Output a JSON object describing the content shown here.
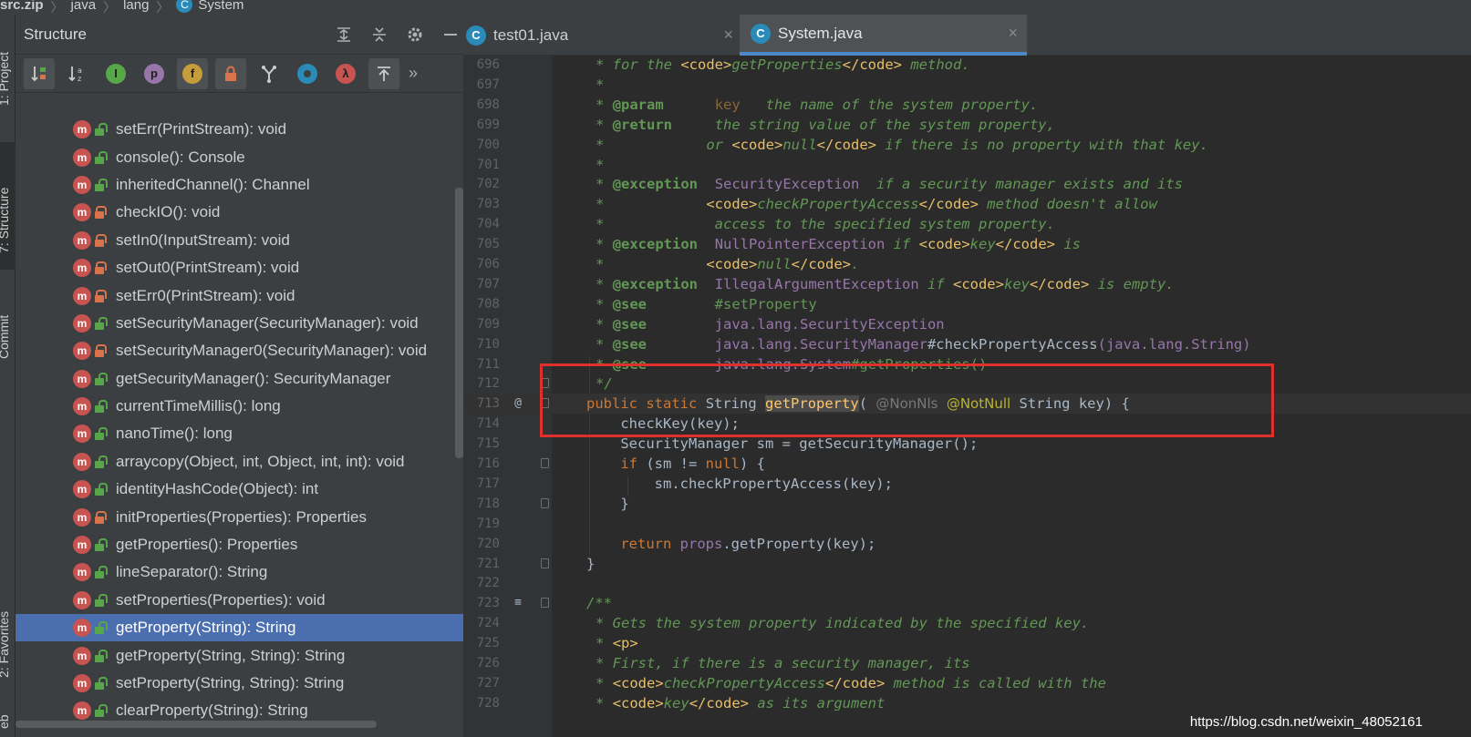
{
  "breadcrumb": {
    "items": [
      "src.zip",
      "java",
      "lang",
      "System"
    ]
  },
  "left_stripe": {
    "project_label": "1: Project",
    "structure_label": "7: Structure",
    "commit_label": "Commit",
    "favorites_label": "2: Favorites",
    "bottom_label": "eb"
  },
  "structure": {
    "title": "Structure",
    "toolbar": {
      "sort_visibility": "↓",
      "sort_alpha": "az",
      "show_inherited": "I",
      "show_properties": "p",
      "show_fields": "f",
      "show_non_public": "🔒",
      "show_anonymous": "Y",
      "show_classes": "●",
      "show_lambdas": "λ",
      "autoscroll": "⤒",
      "more": "»"
    },
    "items": [
      {
        "label": "setErr(PrintStream): void",
        "visibility": "public"
      },
      {
        "label": "console(): Console",
        "visibility": "public"
      },
      {
        "label": "inheritedChannel(): Channel",
        "visibility": "public"
      },
      {
        "label": "checkIO(): void",
        "visibility": "private"
      },
      {
        "label": "setIn0(InputStream): void",
        "visibility": "private"
      },
      {
        "label": "setOut0(PrintStream): void",
        "visibility": "private"
      },
      {
        "label": "setErr0(PrintStream): void",
        "visibility": "private"
      },
      {
        "label": "setSecurityManager(SecurityManager): void",
        "visibility": "public"
      },
      {
        "label": "setSecurityManager0(SecurityManager): void",
        "visibility": "private"
      },
      {
        "label": "getSecurityManager(): SecurityManager",
        "visibility": "public"
      },
      {
        "label": "currentTimeMillis(): long",
        "visibility": "public"
      },
      {
        "label": "nanoTime(): long",
        "visibility": "public"
      },
      {
        "label": "arraycopy(Object, int, Object, int, int): void",
        "visibility": "public"
      },
      {
        "label": "identityHashCode(Object): int",
        "visibility": "public"
      },
      {
        "label": "initProperties(Properties): Properties",
        "visibility": "private"
      },
      {
        "label": "getProperties(): Properties",
        "visibility": "public"
      },
      {
        "label": "lineSeparator(): String",
        "visibility": "public"
      },
      {
        "label": "setProperties(Properties): void",
        "visibility": "public"
      },
      {
        "label": "getProperty(String): String",
        "visibility": "public",
        "selected": true
      },
      {
        "label": "getProperty(String, String): String",
        "visibility": "public"
      },
      {
        "label": "setProperty(String, String): String",
        "visibility": "public"
      },
      {
        "label": "clearProperty(String): String",
        "visibility": "public"
      }
    ],
    "method_icon": "m"
  },
  "tabs": [
    {
      "label": "test01.java",
      "active": false,
      "close": "×"
    },
    {
      "label": "System.java",
      "active": true,
      "close": "×"
    }
  ],
  "editor": {
    "line_numbers": [
      "696",
      "697",
      "698",
      "699",
      "700",
      "701",
      "702",
      "703",
      "704",
      "705",
      "706",
      "707",
      "708",
      "709",
      "710",
      "711",
      "712",
      "713",
      "714",
      "715",
      "716",
      "717",
      "718",
      "719",
      "720",
      "721",
      "722",
      "723",
      "724",
      "725",
      "726",
      "727",
      "728"
    ],
    "markers": {
      "713": "@",
      "723": "≡"
    },
    "fragments": {
      "star": "*",
      "star_close": "*/",
      "doc_open": "/**",
      "for_the": " for the ",
      "code_open": "<code>",
      "code_close": "</code>",
      "get_properties": "getProperties",
      "method": " method.",
      "param": "@param",
      "return": "@return",
      "exception": "@exception",
      "see": "@see",
      "key": "key",
      "key_desc": "   the name of the system property.",
      "return_desc": "the string value of the system property,",
      "or": "or ",
      "null": "null",
      "no_property": " if there is no property with that key.",
      "security_exception": "SecurityException",
      "security_desc": "  if a security manager exists and its",
      "check_property_access": "checkPropertyAccess",
      "doesnt_allow": " method doesn't allow",
      "access_desc": " access to the specified system property.",
      "npe": "NullPointerException",
      "if": " if ",
      "is": " is",
      "null_dot": ".",
      "iae": "IllegalArgumentException",
      "is_empty": " is empty.",
      "see_set_property": "#setProperty",
      "see_security_exception": "java.lang.SecurityException",
      "see_security_manager": "java.lang.SecurityManager",
      "see_cpa": "#checkPropertyAccess",
      "see_string": "(java.lang.String)",
      "see_system": "java.lang.System",
      "see_get_props": "#getProperties()",
      "public": "public",
      "static": "static",
      "string": "String",
      "get_property": "getProperty",
      "paren_open": "(",
      "non_nls": "@NonNls",
      "not_null": "@NotNull",
      "key_brace": " key) {",
      "check_key": "checkKey",
      "key_call": "(key);",
      "security_manager_decl": "SecurityManager sm = ",
      "get_security_manager": "getSecurityManager",
      "call_end": "();",
      "if_kw": "if",
      "sm_cond": " (sm != ",
      "null_kw": "null",
      "cond_end": ") {",
      "sm_check": "sm.checkPropertyAccess(key);",
      "close_brace": "}",
      "return_kw": "return",
      "props": "props",
      "get_property_call": ".getProperty(key);",
      "gets_desc": " Gets the system property indicated by the specified key.",
      "p_tag": "<p>",
      "first_desc": " First, if there is a security manager, its",
      "called_desc": " method is called with the",
      "as_arg": " as its argument"
    }
  },
  "watermark": "https://blog.csdn.net/weixin_48052161",
  "colors": {
    "accent": "#4a88c7",
    "selection": "#4b6eaf",
    "highlight_box": "#e0302c"
  }
}
